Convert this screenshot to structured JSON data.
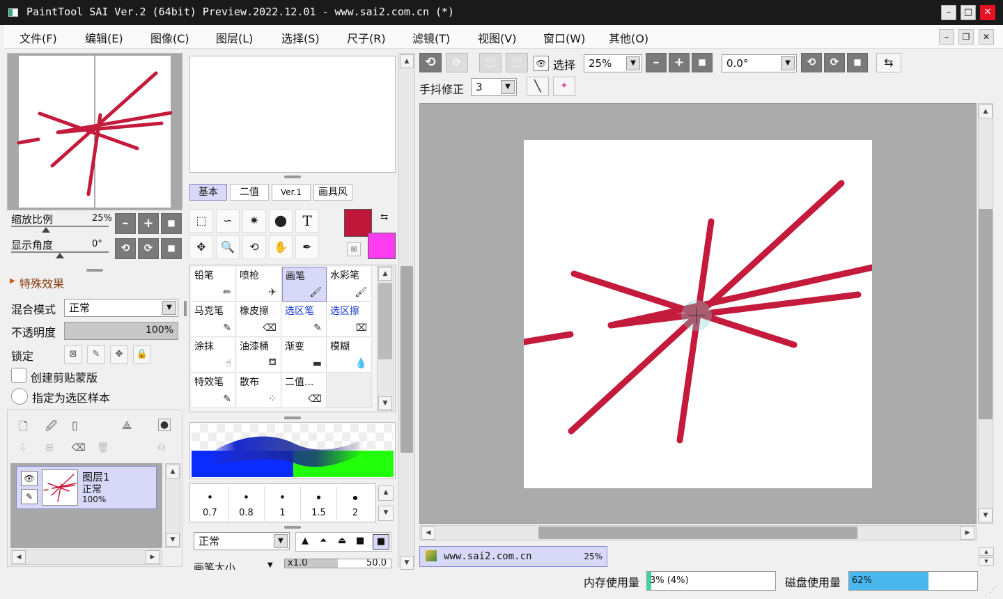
{
  "window": {
    "title": "PaintTool SAI Ver.2 (64bit) Preview.2022.12.01 - www.sai2.com.cn (*)",
    "minimize": "–",
    "maximize": "□",
    "close": "✕"
  },
  "menu": [
    "文件(F)",
    "编辑(E)",
    "图像(C)",
    "图层(L)",
    "选择(S)",
    "尺子(R)",
    "滤镜(T)",
    "视图(V)",
    "窗口(W)",
    "其他(O)"
  ],
  "navigator": {
    "zoom_label": "缩放比例",
    "zoom_value": "25%",
    "angle_label": "显示角度",
    "angle_value": "0°"
  },
  "special_effects": "特殊效果",
  "layer_props": {
    "blend_label": "混合模式",
    "blend_value": "正常",
    "opacity_label": "不透明度",
    "opacity_value": "100%",
    "lock_label": "锁定",
    "clip_label": "创建剪贴蒙版",
    "sample_label": "指定为选区样本"
  },
  "layer": {
    "name": "图层1",
    "mode": "正常",
    "opacity": "100%"
  },
  "tool_tabs": [
    "基本",
    "二值",
    "Ver.1",
    "画具风"
  ],
  "colors": {
    "primary": "#c0163a",
    "secondary": "#ff3cf0",
    "stroke": "#c41a3c",
    "accent_blue": "#4ab8ee"
  },
  "brushes": [
    {
      "name": "铅笔",
      "icon": "pencil-icon"
    },
    {
      "name": "喷枪",
      "icon": "airbrush-icon"
    },
    {
      "name": "画笔",
      "icon": "brush-icon",
      "selected": true
    },
    {
      "name": "水彩笔",
      "icon": "watercolor-icon"
    },
    {
      "name": "马克笔",
      "icon": "marker-icon"
    },
    {
      "name": "橡皮擦",
      "icon": "eraser-icon"
    },
    {
      "name": "选区笔",
      "icon": "selpen-icon",
      "blue": true
    },
    {
      "name": "选区擦",
      "icon": "selerase-icon",
      "blue": true
    },
    {
      "name": "涂抹",
      "icon": "smudge-icon"
    },
    {
      "name": "油漆桶",
      "icon": "bucket-icon"
    },
    {
      "name": "渐变",
      "icon": "gradient-icon"
    },
    {
      "name": "模糊",
      "icon": "blur-icon"
    },
    {
      "name": "特效笔",
      "icon": "fxpen-icon"
    },
    {
      "name": "散布",
      "icon": "scatter-icon"
    },
    {
      "name": "二值...",
      "icon": "binary-icon"
    }
  ],
  "brush_sizes": [
    "0.7",
    "0.8",
    "1",
    "1.5",
    "2"
  ],
  "brush_mode": "正常",
  "brush_size_label": "画笔大小",
  "brush_size_mult": "x1.0",
  "brush_size_value": "50.0",
  "toolbar": {
    "select_label": "选择",
    "zoom": "25%",
    "angle": "0.0°",
    "stabilizer_label": "手抖修正",
    "stabilizer_value": "3"
  },
  "doc_tab": {
    "name": "www.sai2.com.cn",
    "zoom": "25%"
  },
  "status": {
    "mem_label": "内存使用量",
    "mem_value": "3% (4%)",
    "mem_fraction": 0.03,
    "disk_label": "磁盘使用量",
    "disk_value": "62%",
    "disk_fraction": 0.62
  }
}
